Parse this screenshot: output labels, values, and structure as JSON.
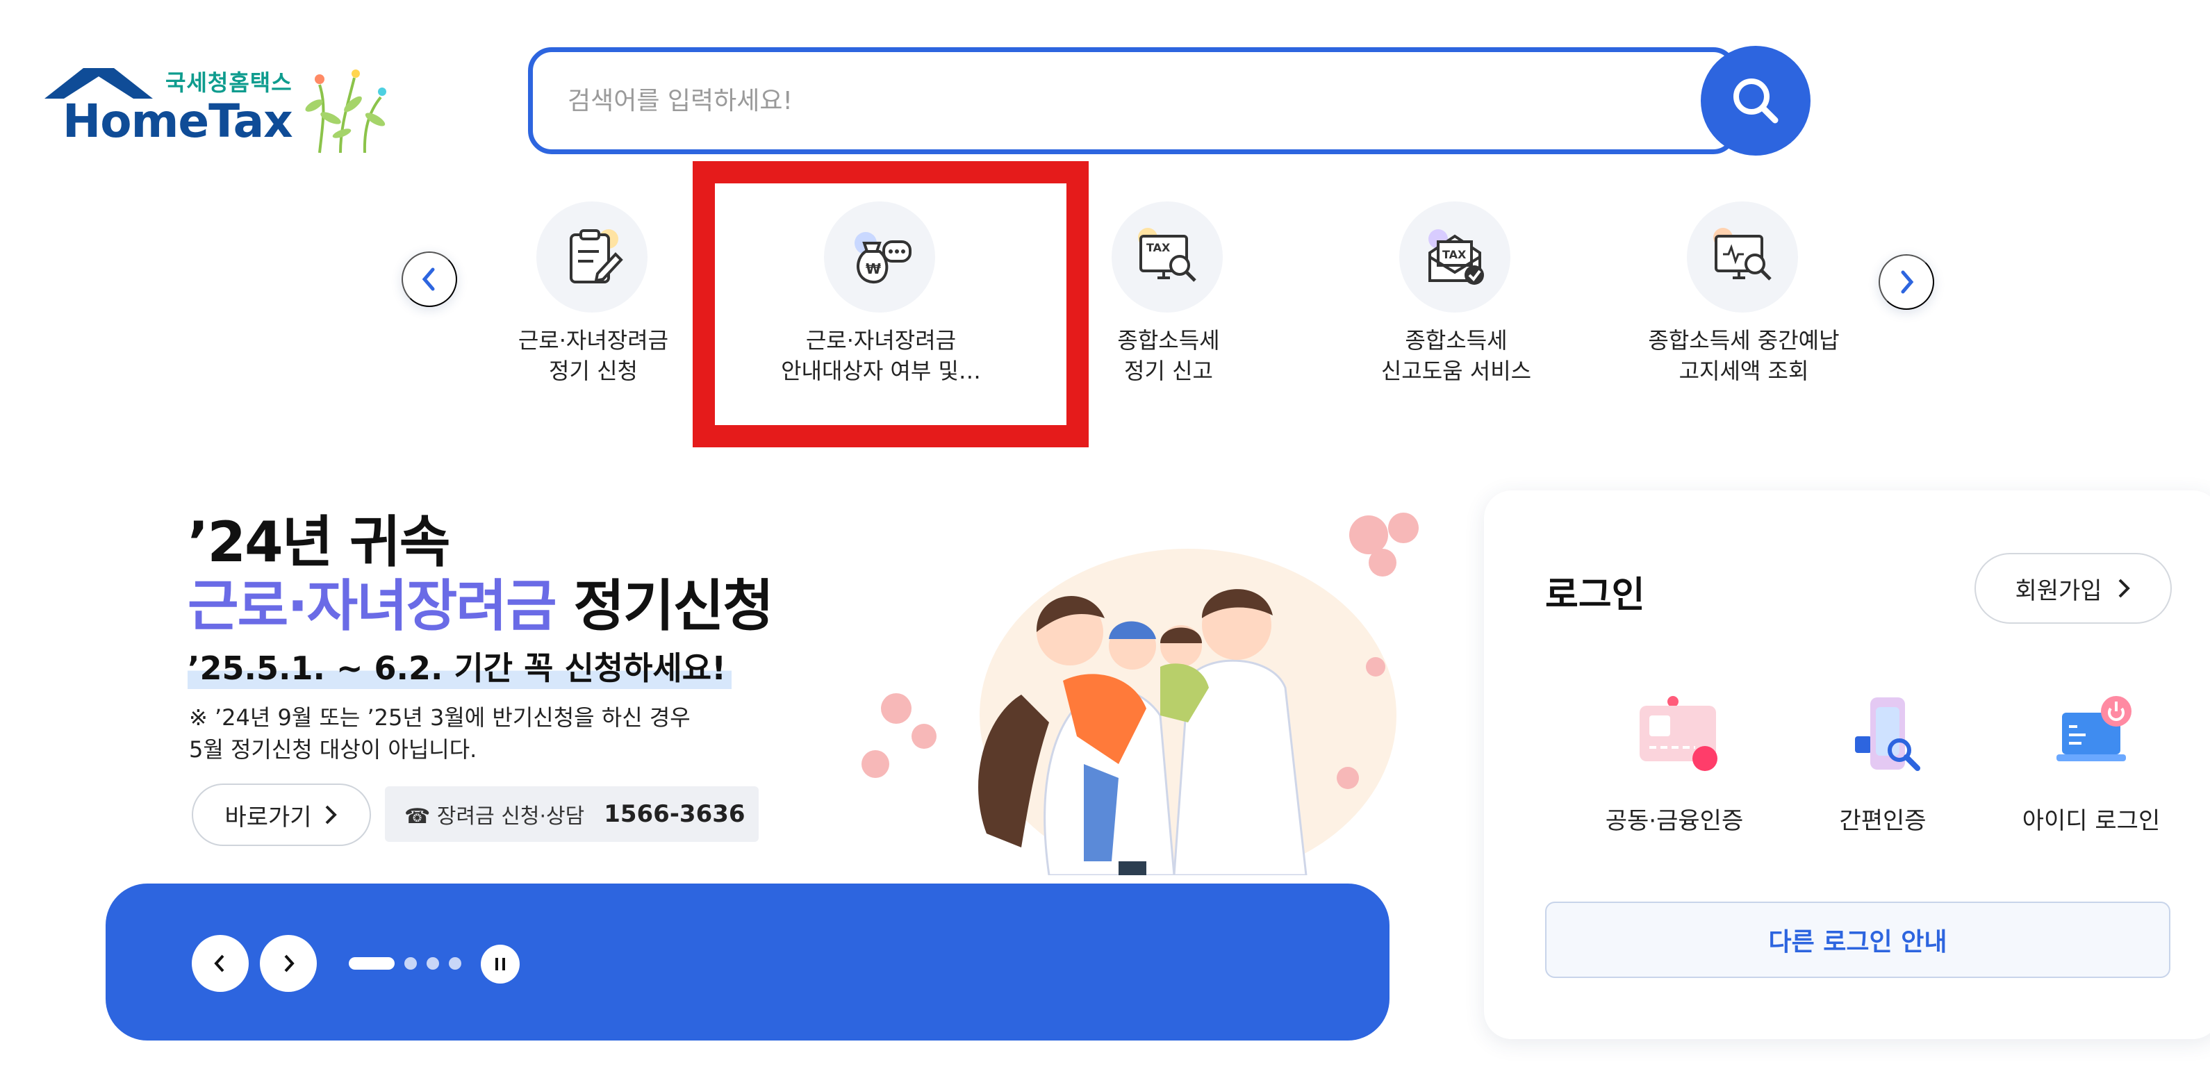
{
  "logo": {
    "sub": "국세청홈택스",
    "main": "HomeTax"
  },
  "search": {
    "placeholder": "검색어를 입력하세요!"
  },
  "quick_menu": {
    "items": [
      {
        "label": "근로·자녀장려금\n정기 신청",
        "icon": "document-pen-icon"
      },
      {
        "label": "근로·자녀장려금\n안내대상자 여부 및…",
        "icon": "money-bag-chat-icon"
      },
      {
        "label": "종합소득세\n정기 신고",
        "icon": "tax-monitor-search-icon"
      },
      {
        "label": "종합소득세\n신고도움 서비스",
        "icon": "tax-envelope-check-icon"
      },
      {
        "label": "종합소득세 중간예납\n고지세액 조회",
        "icon": "monitor-won-search-icon"
      }
    ]
  },
  "banner": {
    "title1": "’24년 귀속",
    "title2_highlight": "근로·자녀장려금",
    "title2_rest": " 정기신청",
    "date": "’25.5.1. ~ 6.2. 기간 꼭 신청하세요!",
    "note": "※ ’24년 9월 또는 ’25년 3월에 반기신청을 하신 경우\n    5월 정기신청 대상이 아닙니다.",
    "go_label": "바로가기",
    "phone_label": "☎ 장려금 신청·상담",
    "phone_number": "1566-3636",
    "slides_total": 4,
    "slide_active": 1
  },
  "login": {
    "title": "로그인",
    "join_label": "회원가입",
    "options": [
      {
        "label": "공동·금융인증",
        "icon": "certificate-card-icon"
      },
      {
        "label": "간편인증",
        "icon": "phone-search-icon"
      },
      {
        "label": "아이디 로그인",
        "icon": "laptop-power-icon"
      }
    ],
    "other_label": "다른 로그인 안내"
  },
  "colors": {
    "brand_blue": "#2d65df",
    "highlight_red": "#e51b1b",
    "title_purple": "#6a6be6",
    "logo_navy": "#0f4c97",
    "logo_teal": "#0e9c8e"
  }
}
